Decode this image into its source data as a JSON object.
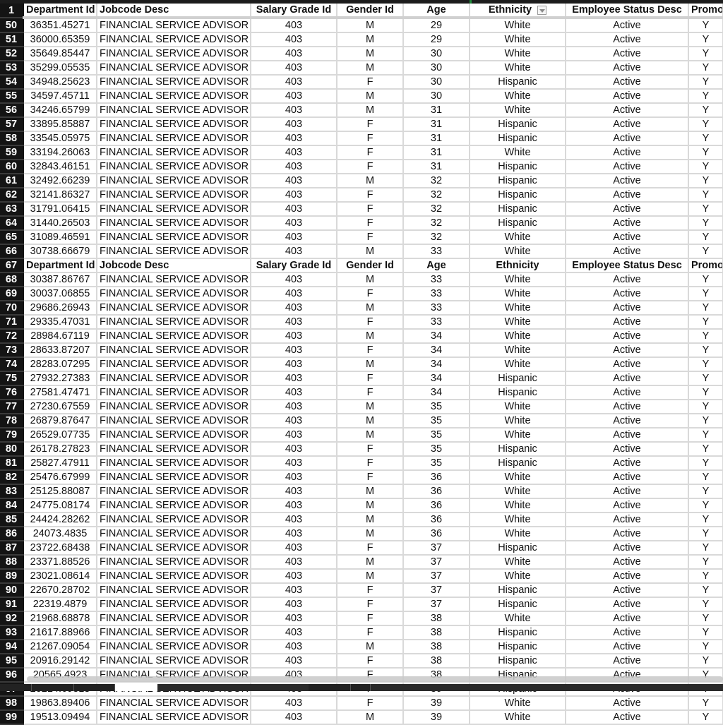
{
  "sheet": {
    "columns": [
      "Department Id",
      "Jobcode Desc",
      "Salary Grade Id",
      "Gender Id",
      "Age",
      "Ethnicity",
      "Employee Status Desc",
      "Promo"
    ],
    "filter_column": "Ethnicity",
    "header_row_number": "1",
    "rows": [
      {
        "n": "50",
        "dept": "36351.45271",
        "job": "FINANCIAL SERVICE ADVISOR",
        "grade": "403",
        "gender": "M",
        "age": "29",
        "eth": "White",
        "status": "Active",
        "promo": "Y"
      },
      {
        "n": "51",
        "dept": "36000.65359",
        "job": "FINANCIAL SERVICE ADVISOR",
        "grade": "403",
        "gender": "M",
        "age": "29",
        "eth": "White",
        "status": "Active",
        "promo": "Y"
      },
      {
        "n": "52",
        "dept": "35649.85447",
        "job": "FINANCIAL SERVICE ADVISOR",
        "grade": "403",
        "gender": "M",
        "age": "30",
        "eth": "White",
        "status": "Active",
        "promo": "Y"
      },
      {
        "n": "53",
        "dept": "35299.05535",
        "job": "FINANCIAL SERVICE ADVISOR",
        "grade": "403",
        "gender": "M",
        "age": "30",
        "eth": "White",
        "status": "Active",
        "promo": "Y"
      },
      {
        "n": "54",
        "dept": "34948.25623",
        "job": "FINANCIAL SERVICE ADVISOR",
        "grade": "403",
        "gender": "F",
        "age": "30",
        "eth": "Hispanic",
        "status": "Active",
        "promo": "Y"
      },
      {
        "n": "55",
        "dept": "34597.45711",
        "job": "FINANCIAL SERVICE ADVISOR",
        "grade": "403",
        "gender": "M",
        "age": "30",
        "eth": "White",
        "status": "Active",
        "promo": "Y"
      },
      {
        "n": "56",
        "dept": "34246.65799",
        "job": "FINANCIAL SERVICE ADVISOR",
        "grade": "403",
        "gender": "M",
        "age": "31",
        "eth": "White",
        "status": "Active",
        "promo": "Y"
      },
      {
        "n": "57",
        "dept": "33895.85887",
        "job": "FINANCIAL SERVICE ADVISOR",
        "grade": "403",
        "gender": "F",
        "age": "31",
        "eth": "Hispanic",
        "status": "Active",
        "promo": "Y"
      },
      {
        "n": "58",
        "dept": "33545.05975",
        "job": "FINANCIAL SERVICE ADVISOR",
        "grade": "403",
        "gender": "F",
        "age": "31",
        "eth": "Hispanic",
        "status": "Active",
        "promo": "Y"
      },
      {
        "n": "59",
        "dept": "33194.26063",
        "job": "FINANCIAL SERVICE ADVISOR",
        "grade": "403",
        "gender": "F",
        "age": "31",
        "eth": "White",
        "status": "Active",
        "promo": "Y"
      },
      {
        "n": "60",
        "dept": "32843.46151",
        "job": "FINANCIAL SERVICE ADVISOR",
        "grade": "403",
        "gender": "F",
        "age": "31",
        "eth": "Hispanic",
        "status": "Active",
        "promo": "Y"
      },
      {
        "n": "61",
        "dept": "32492.66239",
        "job": "FINANCIAL SERVICE ADVISOR",
        "grade": "403",
        "gender": "M",
        "age": "32",
        "eth": "Hispanic",
        "status": "Active",
        "promo": "Y"
      },
      {
        "n": "62",
        "dept": "32141.86327",
        "job": "FINANCIAL SERVICE ADVISOR",
        "grade": "403",
        "gender": "F",
        "age": "32",
        "eth": "Hispanic",
        "status": "Active",
        "promo": "Y"
      },
      {
        "n": "63",
        "dept": "31791.06415",
        "job": "FINANCIAL SERVICE ADVISOR",
        "grade": "403",
        "gender": "F",
        "age": "32",
        "eth": "Hispanic",
        "status": "Active",
        "promo": "Y"
      },
      {
        "n": "64",
        "dept": "31440.26503",
        "job": "FINANCIAL SERVICE ADVISOR",
        "grade": "403",
        "gender": "F",
        "age": "32",
        "eth": "Hispanic",
        "status": "Active",
        "promo": "Y"
      },
      {
        "n": "65",
        "dept": "31089.46591",
        "job": "FINANCIAL SERVICE ADVISOR",
        "grade": "403",
        "gender": "F",
        "age": "32",
        "eth": "White",
        "status": "Active",
        "promo": "Y"
      },
      {
        "n": "66",
        "dept": "30738.66679",
        "job": "FINANCIAL SERVICE ADVISOR",
        "grade": "403",
        "gender": "M",
        "age": "33",
        "eth": "White",
        "status": "Active",
        "promo": "Y"
      },
      {
        "n": "67",
        "header": true
      },
      {
        "n": "68",
        "dept": "30387.86767",
        "job": "FINANCIAL SERVICE ADVISOR",
        "grade": "403",
        "gender": "M",
        "age": "33",
        "eth": "White",
        "status": "Active",
        "promo": "Y"
      },
      {
        "n": "69",
        "dept": "30037.06855",
        "job": "FINANCIAL SERVICE ADVISOR",
        "grade": "403",
        "gender": "F",
        "age": "33",
        "eth": "White",
        "status": "Active",
        "promo": "Y"
      },
      {
        "n": "70",
        "dept": "29686.26943",
        "job": "FINANCIAL SERVICE ADVISOR",
        "grade": "403",
        "gender": "M",
        "age": "33",
        "eth": "White",
        "status": "Active",
        "promo": "Y"
      },
      {
        "n": "71",
        "dept": "29335.47031",
        "job": "FINANCIAL SERVICE ADVISOR",
        "grade": "403",
        "gender": "F",
        "age": "33",
        "eth": "White",
        "status": "Active",
        "promo": "Y"
      },
      {
        "n": "72",
        "dept": "28984.67119",
        "job": "FINANCIAL SERVICE ADVISOR",
        "grade": "403",
        "gender": "M",
        "age": "34",
        "eth": "White",
        "status": "Active",
        "promo": "Y"
      },
      {
        "n": "73",
        "dept": "28633.87207",
        "job": "FINANCIAL SERVICE ADVISOR",
        "grade": "403",
        "gender": "F",
        "age": "34",
        "eth": "White",
        "status": "Active",
        "promo": "Y"
      },
      {
        "n": "74",
        "dept": "28283.07295",
        "job": "FINANCIAL SERVICE ADVISOR",
        "grade": "403",
        "gender": "M",
        "age": "34",
        "eth": "White",
        "status": "Active",
        "promo": "Y"
      },
      {
        "n": "75",
        "dept": "27932.27383",
        "job": "FINANCIAL SERVICE ADVISOR",
        "grade": "403",
        "gender": "F",
        "age": "34",
        "eth": "Hispanic",
        "status": "Active",
        "promo": "Y"
      },
      {
        "n": "76",
        "dept": "27581.47471",
        "job": "FINANCIAL SERVICE ADVISOR",
        "grade": "403",
        "gender": "F",
        "age": "34",
        "eth": "Hispanic",
        "status": "Active",
        "promo": "Y"
      },
      {
        "n": "77",
        "dept": "27230.67559",
        "job": "FINANCIAL SERVICE ADVISOR",
        "grade": "403",
        "gender": "M",
        "age": "35",
        "eth": "White",
        "status": "Active",
        "promo": "Y"
      },
      {
        "n": "78",
        "dept": "26879.87647",
        "job": "FINANCIAL SERVICE ADVISOR",
        "grade": "403",
        "gender": "M",
        "age": "35",
        "eth": "White",
        "status": "Active",
        "promo": "Y"
      },
      {
        "n": "79",
        "dept": "26529.07735",
        "job": "FINANCIAL SERVICE ADVISOR",
        "grade": "403",
        "gender": "M",
        "age": "35",
        "eth": "White",
        "status": "Active",
        "promo": "Y"
      },
      {
        "n": "80",
        "dept": "26178.27823",
        "job": "FINANCIAL SERVICE ADVISOR",
        "grade": "403",
        "gender": "F",
        "age": "35",
        "eth": "Hispanic",
        "status": "Active",
        "promo": "Y"
      },
      {
        "n": "81",
        "dept": "25827.47911",
        "job": "FINANCIAL SERVICE ADVISOR",
        "grade": "403",
        "gender": "F",
        "age": "35",
        "eth": "Hispanic",
        "status": "Active",
        "promo": "Y"
      },
      {
        "n": "82",
        "dept": "25476.67999",
        "job": "FINANCIAL SERVICE ADVISOR",
        "grade": "403",
        "gender": "F",
        "age": "36",
        "eth": "White",
        "status": "Active",
        "promo": "Y"
      },
      {
        "n": "83",
        "dept": "25125.88087",
        "job": "FINANCIAL SERVICE ADVISOR",
        "grade": "403",
        "gender": "M",
        "age": "36",
        "eth": "White",
        "status": "Active",
        "promo": "Y"
      },
      {
        "n": "84",
        "dept": "24775.08174",
        "job": "FINANCIAL SERVICE ADVISOR",
        "grade": "403",
        "gender": "M",
        "age": "36",
        "eth": "White",
        "status": "Active",
        "promo": "Y"
      },
      {
        "n": "85",
        "dept": "24424.28262",
        "job": "FINANCIAL SERVICE ADVISOR",
        "grade": "403",
        "gender": "M",
        "age": "36",
        "eth": "White",
        "status": "Active",
        "promo": "Y"
      },
      {
        "n": "86",
        "dept": "24073.4835",
        "job": "FINANCIAL SERVICE ADVISOR",
        "grade": "403",
        "gender": "M",
        "age": "36",
        "eth": "White",
        "status": "Active",
        "promo": "Y"
      },
      {
        "n": "87",
        "dept": "23722.68438",
        "job": "FINANCIAL SERVICE ADVISOR",
        "grade": "403",
        "gender": "F",
        "age": "37",
        "eth": "Hispanic",
        "status": "Active",
        "promo": "Y"
      },
      {
        "n": "88",
        "dept": "23371.88526",
        "job": "FINANCIAL SERVICE ADVISOR",
        "grade": "403",
        "gender": "M",
        "age": "37",
        "eth": "White",
        "status": "Active",
        "promo": "Y"
      },
      {
        "n": "89",
        "dept": "23021.08614",
        "job": "FINANCIAL SERVICE ADVISOR",
        "grade": "403",
        "gender": "M",
        "age": "37",
        "eth": "White",
        "status": "Active",
        "promo": "Y"
      },
      {
        "n": "90",
        "dept": "22670.28702",
        "job": "FINANCIAL SERVICE ADVISOR",
        "grade": "403",
        "gender": "F",
        "age": "37",
        "eth": "Hispanic",
        "status": "Active",
        "promo": "Y"
      },
      {
        "n": "91",
        "dept": "22319.4879",
        "job": "FINANCIAL SERVICE ADVISOR",
        "grade": "403",
        "gender": "F",
        "age": "37",
        "eth": "Hispanic",
        "status": "Active",
        "promo": "Y"
      },
      {
        "n": "92",
        "dept": "21968.68878",
        "job": "FINANCIAL SERVICE ADVISOR",
        "grade": "403",
        "gender": "F",
        "age": "38",
        "eth": "White",
        "status": "Active",
        "promo": "Y"
      },
      {
        "n": "93",
        "dept": "21617.88966",
        "job": "FINANCIAL SERVICE ADVISOR",
        "grade": "403",
        "gender": "F",
        "age": "38",
        "eth": "Hispanic",
        "status": "Active",
        "promo": "Y"
      },
      {
        "n": "94",
        "dept": "21267.09054",
        "job": "FINANCIAL SERVICE ADVISOR",
        "grade": "403",
        "gender": "M",
        "age": "38",
        "eth": "Hispanic",
        "status": "Active",
        "promo": "Y"
      },
      {
        "n": "95",
        "dept": "20916.29142",
        "job": "FINANCIAL SERVICE ADVISOR",
        "grade": "403",
        "gender": "F",
        "age": "38",
        "eth": "Hispanic",
        "status": "Active",
        "promo": "Y"
      },
      {
        "n": "96",
        "dept": "20565.4923",
        "job": "FINANCIAL SERVICE ADVISOR",
        "grade": "403",
        "gender": "F",
        "age": "38",
        "eth": "Hispanic",
        "status": "Active",
        "promo": "Y"
      },
      {
        "n": "97",
        "dept": "20214.69318",
        "job": "FINANCIAL SERVICE ADVISOR",
        "grade": "403",
        "gender": "F",
        "age": "39",
        "eth": "Hispanic",
        "status": "Active",
        "promo": "Y"
      },
      {
        "n": "98",
        "dept": "19863.89406",
        "job": "FINANCIAL SERVICE ADVISOR",
        "grade": "403",
        "gender": "F",
        "age": "39",
        "eth": "White",
        "status": "Active",
        "promo": "Y"
      },
      {
        "n": "99",
        "dept": "19513.09494",
        "job": "FINANCIAL SERVICE ADVISOR",
        "grade": "403",
        "gender": "M",
        "age": "39",
        "eth": "White",
        "status": "Active",
        "promo": "Y"
      }
    ]
  },
  "icons": {
    "filter": "filter-dropdown-icon"
  }
}
